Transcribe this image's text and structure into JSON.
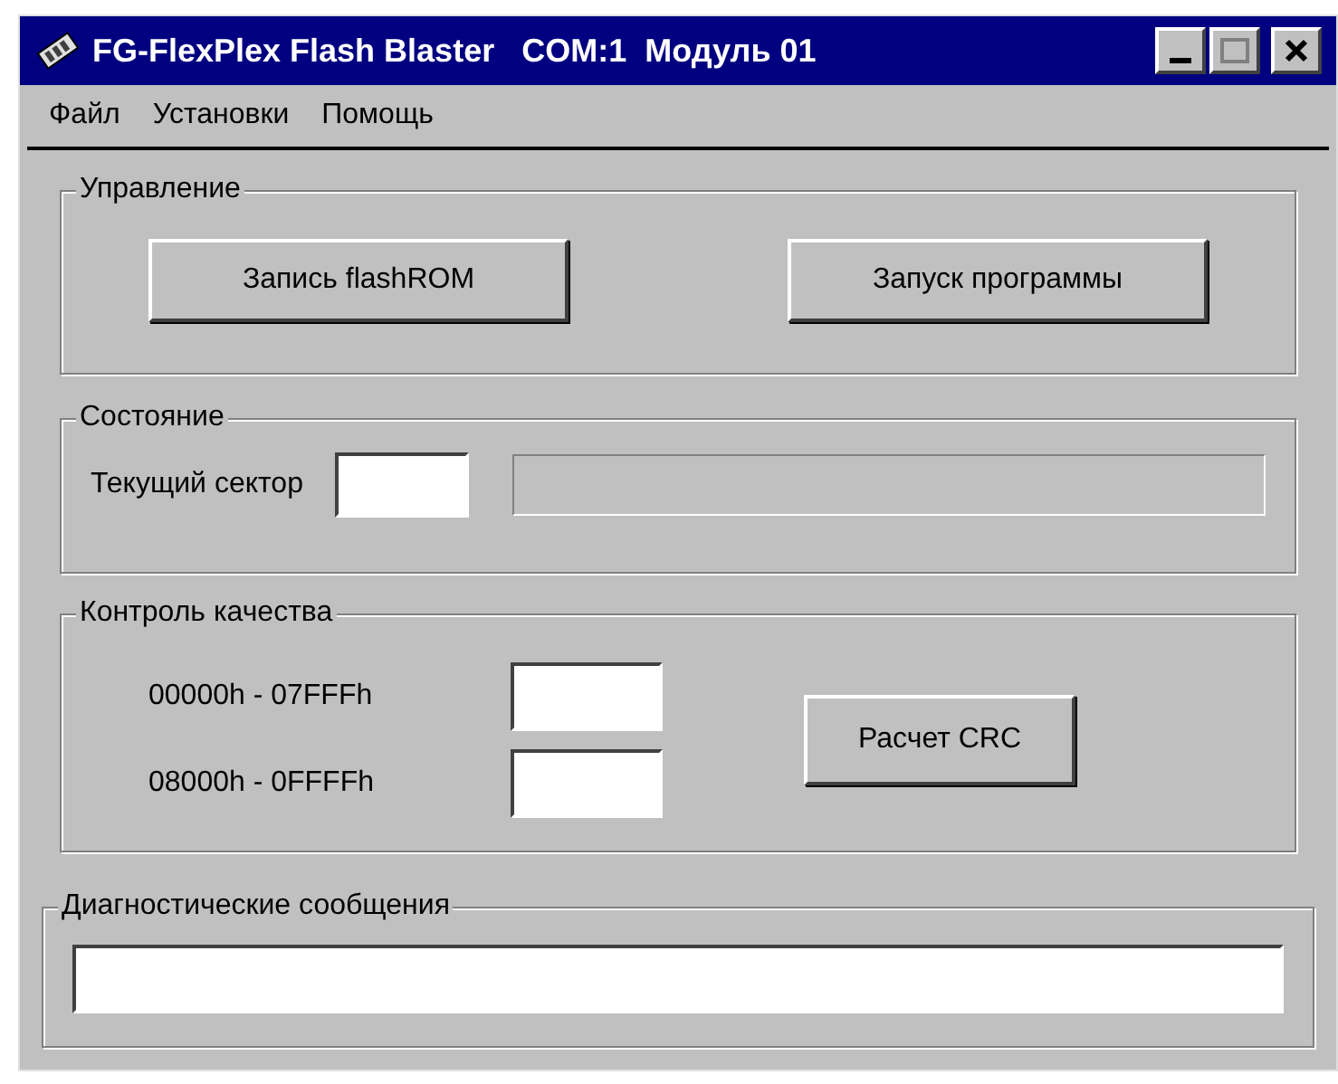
{
  "window": {
    "title": "FG-FlexPlex Flash Blaster   COM:1  Модуль 01"
  },
  "menu": [
    "Файл",
    "Установки",
    "Помощь"
  ],
  "control_group": {
    "title": "Управление",
    "buttons": [
      "Запись flashROM",
      "Запуск программы"
    ]
  },
  "status_group": {
    "title": "Состояние",
    "sector_label": "Текущий сектор",
    "progress": {
      "level": 0
    }
  },
  "quality_group": {
    "title": "Контроль качества",
    "ranges": [
      {
        "label": "00000h - 07FFFh"
      },
      {
        "label": "08000h - 0FFFFh"
      }
    ],
    "button": "Расчет CRC"
  },
  "diagnostics": {
    "title": "Диагностические сообщения"
  }
}
